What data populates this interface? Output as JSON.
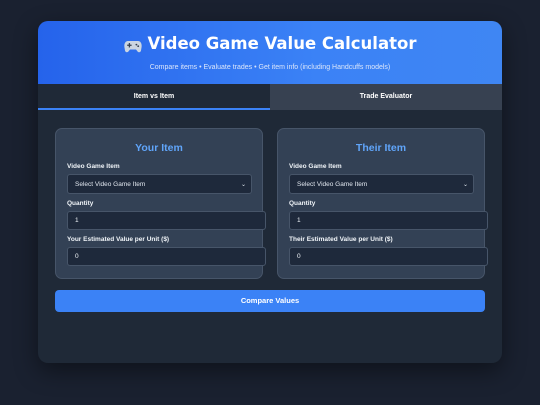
{
  "header": {
    "title": "Video Game Value Calculator",
    "subtitle": "Compare items • Evaluate trades • Get item info (including Handcuffs models)"
  },
  "tabs": [
    {
      "label": "Item vs Item",
      "active": true
    },
    {
      "label": "Trade Evaluator",
      "active": false
    }
  ],
  "your_item": {
    "title": "Your Item",
    "item_label": "Video Game Item",
    "item_selected": "Select Video Game Item",
    "quantity_label": "Quantity",
    "quantity_value": "1",
    "value_label": "Your Estimated Value per Unit ($)",
    "value_value": "0"
  },
  "their_item": {
    "title": "Their Item",
    "item_label": "Video Game Item",
    "item_selected": "Select Video Game Item",
    "quantity_label": "Quantity",
    "quantity_value": "1",
    "value_label": "Their Estimated Value per Unit ($)",
    "value_value": "0"
  },
  "compare_button": "Compare Values",
  "colors": {
    "accent": "#3b82f6",
    "panel_title": "#60a5fa",
    "background": "#1a2130"
  },
  "icons": {
    "title_icon": "gamepad-icon",
    "select_chevron": "chevron-down-icon"
  }
}
